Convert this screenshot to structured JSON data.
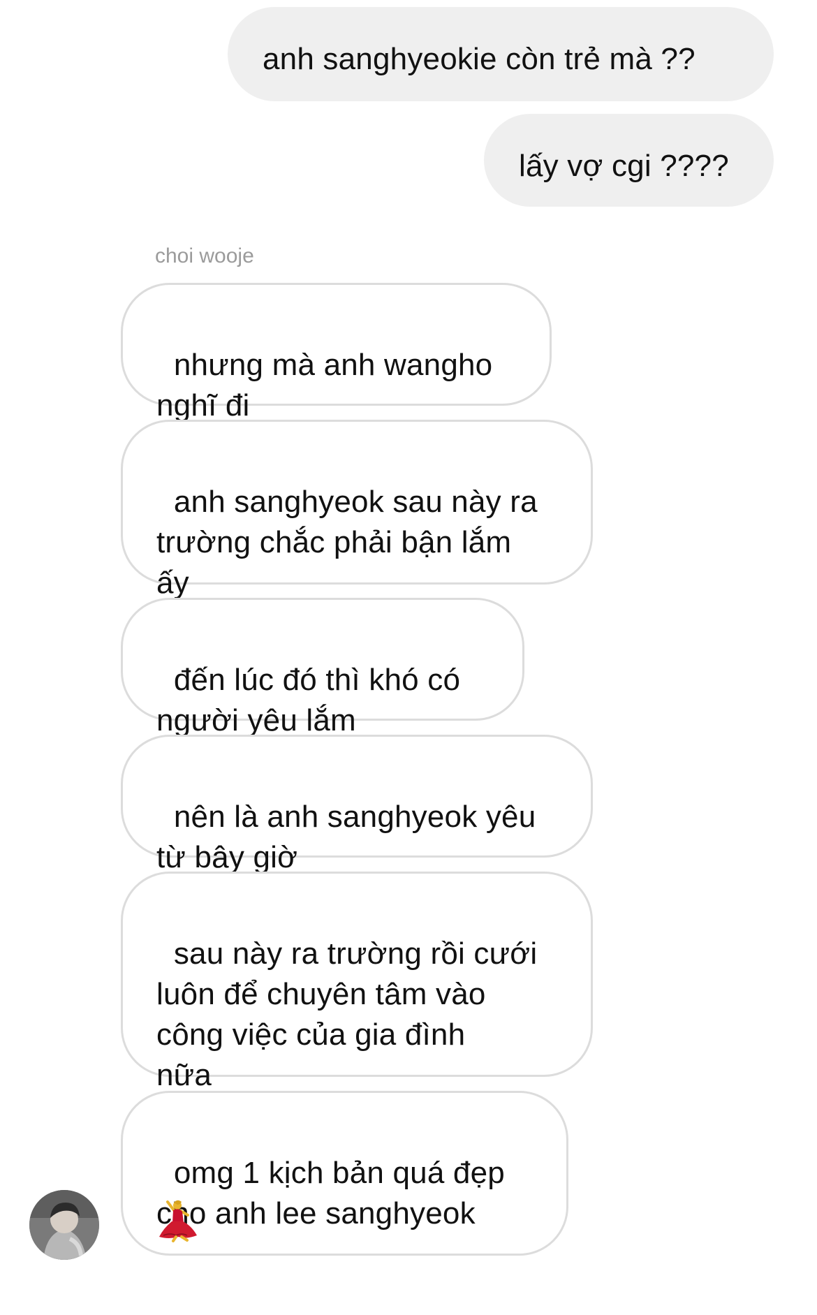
{
  "chat": {
    "sent": [
      {
        "text": "anh sanghyeokie còn trẻ mà ??"
      },
      {
        "text": "lấy vợ cgi ????"
      }
    ],
    "sender_name": "choi wooje",
    "received": [
      {
        "text": "nhưng mà anh wangho\nnghĩ đi"
      },
      {
        "text": "anh sanghyeok sau này ra\ntrường chắc phải bận lắm\nấy"
      },
      {
        "text": "đến lúc đó thì khó có\nngười yêu lắm"
      },
      {
        "text": "nên là anh sanghyeok yêu\ntừ bây giờ"
      },
      {
        "text": "sau này ra trường rồi cưới\nluôn để chuyên tâm vào\ncông việc của gia đình\nnữa"
      },
      {
        "text": "omg 1 kịch bản quá đẹp\ncho anh lee sanghyeok"
      }
    ],
    "last_message_emoji": "woman-dancing-icon",
    "avatar_icon": "user-avatar"
  },
  "colors": {
    "sent_bubble": "#efefef",
    "received_border": "#dcdcdc",
    "sender_name": "#9b9b9b",
    "text": "#111111"
  }
}
